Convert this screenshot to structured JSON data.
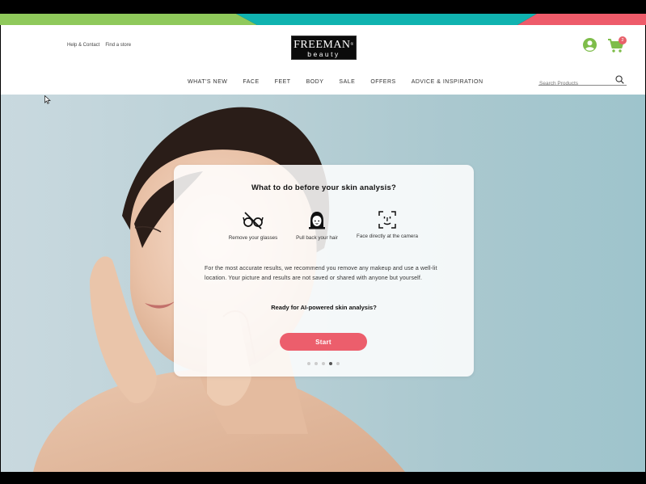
{
  "header": {
    "util_links": [
      "Help & Contact",
      "Find a store"
    ],
    "logo": {
      "line1": "FREEMAN",
      "line2": "beauty",
      "reg": "®"
    },
    "cart_count": "2",
    "nav": [
      "WHAT'S NEW",
      "FACE",
      "FEET",
      "BODY",
      "SALE",
      "OFFERS",
      "ADVICE & INSPIRATION"
    ],
    "search_placeholder": "Search Products",
    "icons": {
      "account": "account-icon",
      "cart": "cart-icon",
      "search": "search-icon"
    }
  },
  "colors": {
    "stripe_green": "#8fc95b",
    "stripe_teal": "#10b3b0",
    "stripe_pink": "#ee5b6a",
    "accent_green": "#7ebd4a",
    "button": "#ec5e6c"
  },
  "card": {
    "title": "What to do before your skin analysis?",
    "tips": [
      {
        "label": "Remove your glasses",
        "icon": "no-glasses-icon"
      },
      {
        "label": "Pull back your hair",
        "icon": "hair-back-icon"
      },
      {
        "label": "Face directly at the camera",
        "icon": "face-scan-icon"
      }
    ],
    "body": "For the most accurate results, we recommend you remove any makeup and use a well-lit location. Your picture and results are not saved or shared with anyone but yourself.",
    "question": "Ready for AI-powered skin analysis?",
    "start_label": "Start",
    "steps_total": 5,
    "steps_active": 4
  }
}
